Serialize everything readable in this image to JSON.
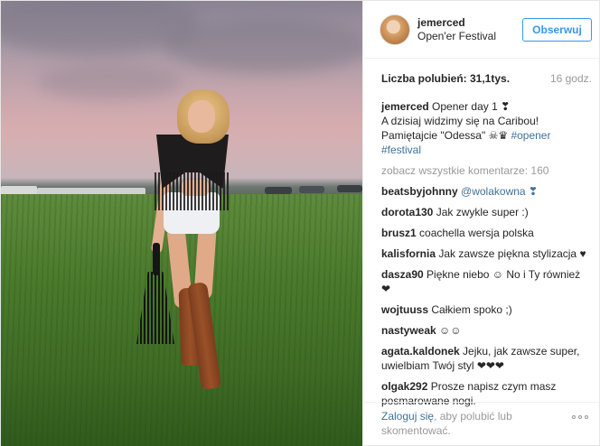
{
  "post": {
    "user": {
      "username": "jemerced",
      "location": "Open'er Festival",
      "follow_label": "Obserwuj"
    },
    "likes_label": "Liczba polubień: 31,1tys.",
    "time_ago": "16 godz.",
    "caption": {
      "user": "jemerced",
      "line1": "Opener day 1 ❣",
      "line2": "A dzisiaj widzimy się na Caribou!",
      "line3_prefix": "Pamiętajcie \"Odessa\" ☠︎♛",
      "hashtag1": "#opener",
      "hashtag2": "#festival"
    },
    "view_all_label": "zobacz wszystkie komentarze: 160",
    "comments": [
      {
        "user": "beatsbyjohnny",
        "text": "@wolakowna ❣",
        "is_mention": true
      },
      {
        "user": "dorota130",
        "text": "Jak zwykle super :)"
      },
      {
        "user": "brusz1",
        "text": "coachella wersja polska"
      },
      {
        "user": "kalisfornia",
        "text": "Jak zawsze piękna stylizacja ♥"
      },
      {
        "user": "dasza90",
        "text": "Piękne niebo ☺ No i Ty również ❤"
      },
      {
        "user": "wojtuuss",
        "text": "Całkiem spoko ;)"
      },
      {
        "user": "nastyweak",
        "text": "☺☺"
      },
      {
        "user": "agata.kaldonek",
        "text": "Jejku, jak zawsze super, uwielbiam Twój styl ❤❤❤"
      },
      {
        "user": "olgak292",
        "text": "Prosze napisz czym masz posmarowane nogi."
      }
    ],
    "footer": {
      "login_link": "Zaloguj się",
      "login_rest": ", aby polubić lub skomentować."
    }
  }
}
